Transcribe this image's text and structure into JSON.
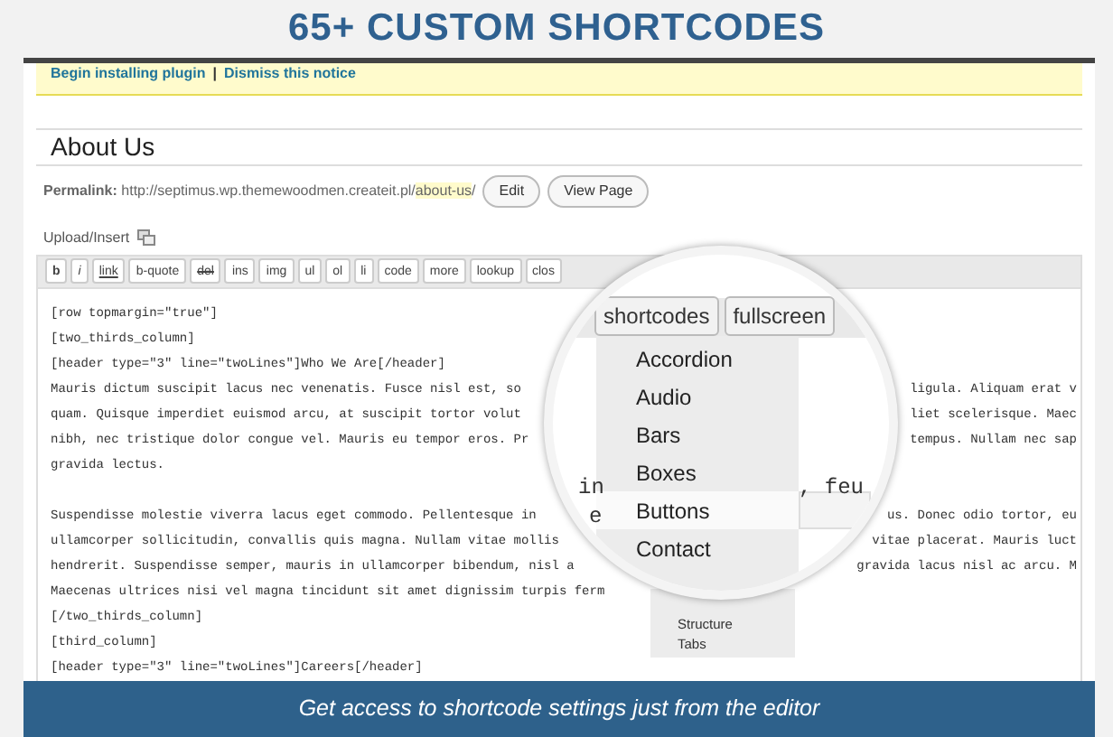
{
  "banner": {
    "title": "65+ CUSTOM SHORTCODES"
  },
  "notice": {
    "links": [
      "Begin installing plugin",
      "Dismiss this notice"
    ],
    "separator": "|"
  },
  "post_title": {
    "value": "About Us"
  },
  "permalink": {
    "label": "Permalink:",
    "url": "http://septimus.wp.themewoodmen.createit.pl/",
    "slug": "about-us",
    "trail": "/",
    "buttons": [
      "Edit",
      "View Page"
    ]
  },
  "upload_insert": {
    "label": "Upload/Insert"
  },
  "toolbar": {
    "buttons": [
      "b",
      "i",
      "link",
      "b-quote",
      "del",
      "ins",
      "img",
      "ul",
      "ol",
      "li",
      "code",
      "more",
      "lookup",
      "clos"
    ]
  },
  "editor": {
    "blocks": [
      [
        {
          "left": "[row topmargin=\"true\"]"
        },
        {
          "left": "[two_thirds_column]"
        },
        {
          "left": "[header type=\"3\" line=\"twoLines\"]Who We Are[/header]"
        },
        {
          "left": "Mauris dictum suscipit lacus nec venenatis. Fusce nisl est, so",
          "right": "ligula. Aliquam erat v"
        },
        {
          "left": "quam. Quisque imperdiet euismod arcu, at suscipit tortor volut",
          "right": "liet scelerisque. Maec"
        },
        {
          "left": "nibh, nec tristique dolor congue vel. Mauris eu tempor eros. Pr",
          "right": "tempus. Nullam nec sap"
        },
        {
          "left": "gravida lectus."
        }
      ],
      [
        {
          "left": "Suspendisse molestie viverra lacus eget commodo. Pellentesque in",
          "right": "us. Donec odio tortor, eu"
        },
        {
          "left": "ullamcorper sollicitudin, convallis quis magna. Nullam vitae mollis",
          "right": "vitae placerat. Mauris luct"
        },
        {
          "left": "hendrerit. Suspendisse semper, mauris in ullamcorper bibendum, nisl a",
          "right": "gravida lacus nisl ac arcu. M"
        },
        {
          "left": "Maecenas ultrices nisi vel magna tincidunt sit amet dignissim turpis ferm"
        },
        {
          "left": "[/two_thirds_column]"
        },
        {
          "left": "[third_column]"
        },
        {
          "left": "[header type=\"3\" line=\"twoLines\"]Careers[/header]"
        }
      ]
    ]
  },
  "magnifier": {
    "buttons": [
      "shortcodes",
      "fullscreen"
    ],
    "menu": [
      {
        "label": "Accordion",
        "selected": false
      },
      {
        "label": "Audio",
        "selected": false
      },
      {
        "label": "Bars",
        "selected": false
      },
      {
        "label": "Boxes",
        "selected": false
      },
      {
        "label": "Buttons",
        "selected": true
      },
      {
        "label": "Contact",
        "selected": false
      }
    ],
    "fragments": [
      "in",
      "e",
      ", feu"
    ]
  },
  "menu_below": {
    "items": [
      "Structure",
      "Tabs"
    ]
  },
  "caption": {
    "text": "Get access to shortcode settings just from the editor"
  }
}
